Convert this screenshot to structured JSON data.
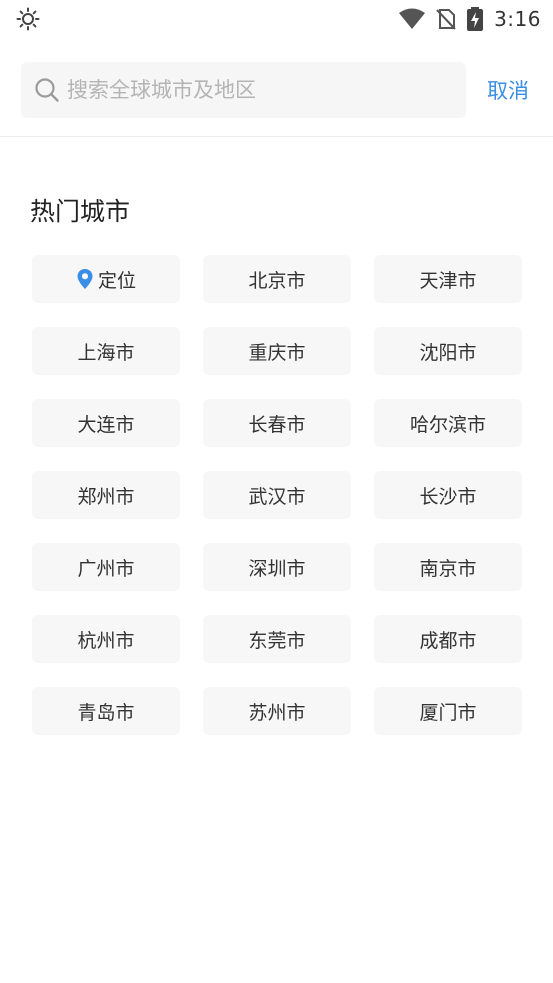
{
  "status_bar": {
    "time": "3:16"
  },
  "search": {
    "placeholder": "搜索全球城市及地区",
    "value": "",
    "cancel_label": "取消"
  },
  "hot_cities": {
    "title": "热门城市",
    "location_label": "定位",
    "cities": [
      "北京市",
      "天津市",
      "上海市",
      "重庆市",
      "沈阳市",
      "大连市",
      "长春市",
      "哈尔滨市",
      "郑州市",
      "武汉市",
      "长沙市",
      "广州市",
      "深圳市",
      "南京市",
      "杭州市",
      "东莞市",
      "成都市",
      "青岛市",
      "苏州市",
      "厦门市"
    ]
  },
  "colors": {
    "accent": "#3a8ee6",
    "chip_bg": "#f7f7f7",
    "search_bg": "#f6f6f6"
  }
}
